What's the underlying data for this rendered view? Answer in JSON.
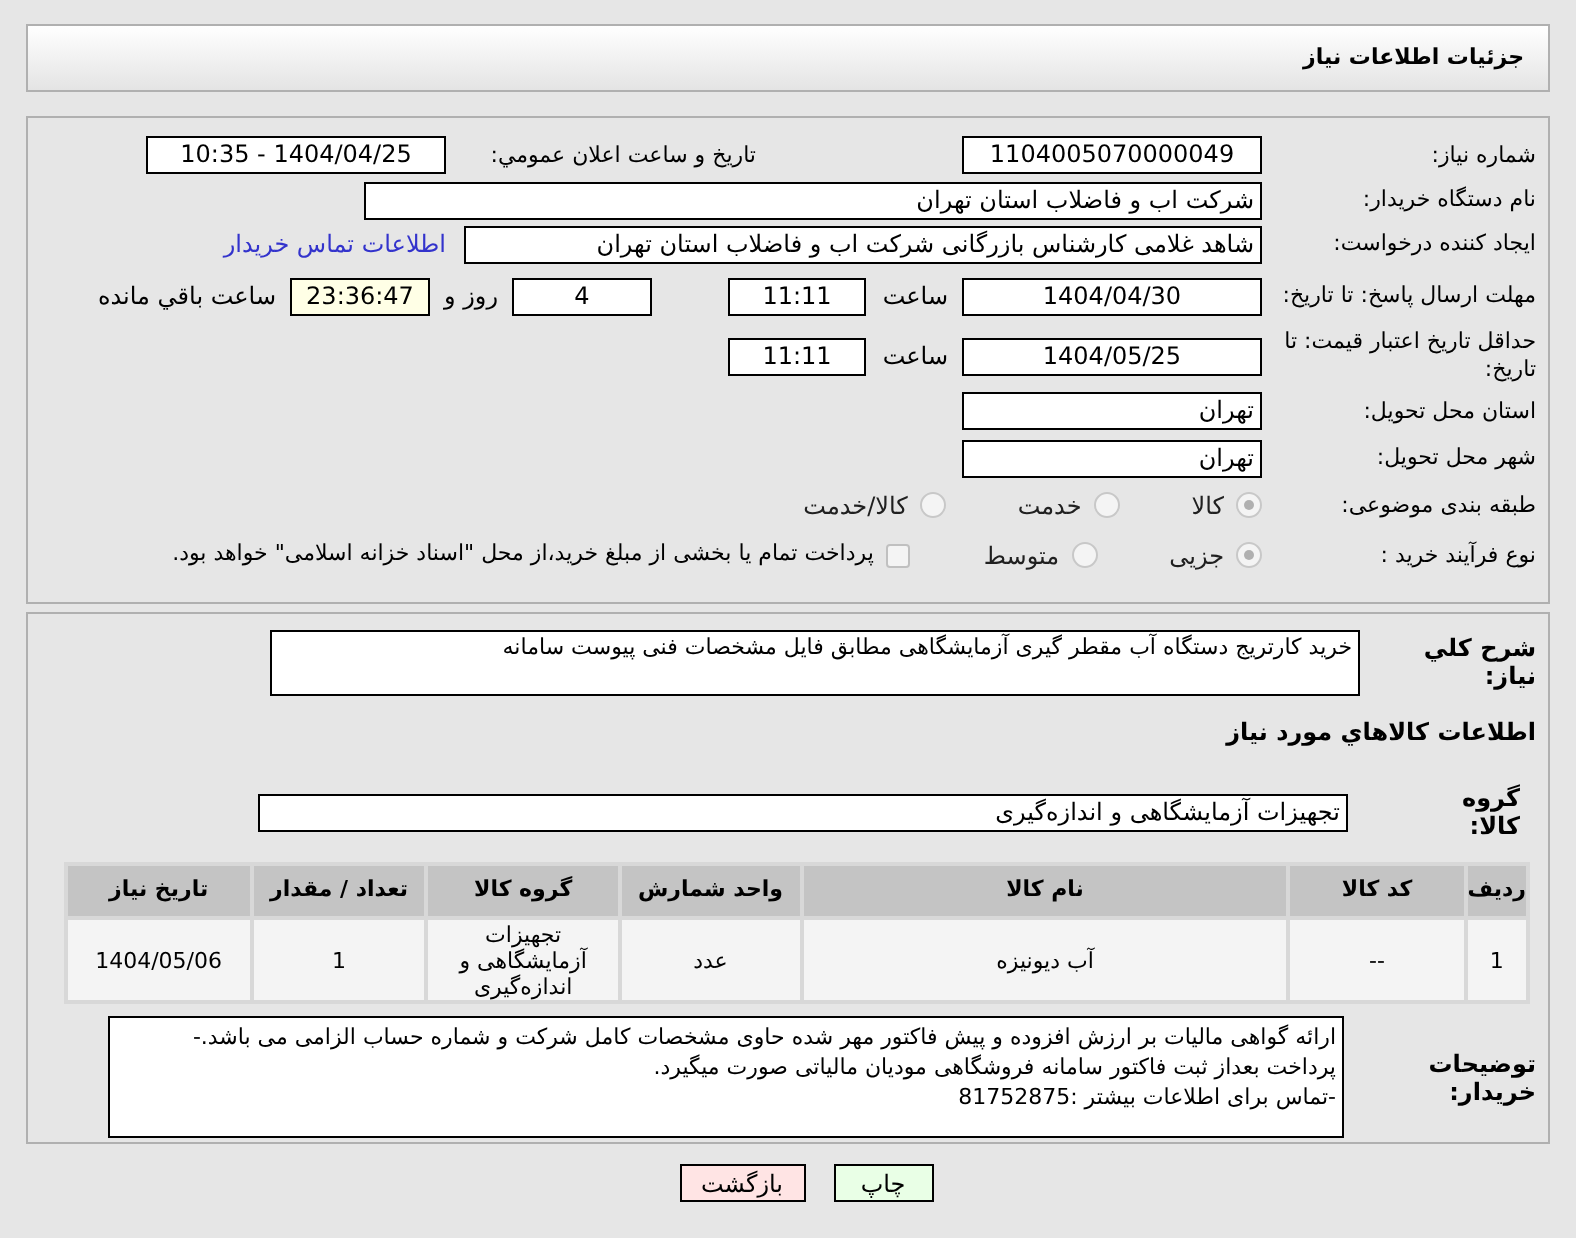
{
  "header": {
    "title": "جزئیات اطلاعات نیاز"
  },
  "need_number": {
    "label": "شماره نیاز:",
    "value": "1104005070000049"
  },
  "announce": {
    "label": "تاریخ و ساعت اعلان عمومي:",
    "value": "1404/04/25 - 10:35"
  },
  "buyer_org": {
    "label": "نام دستگاه خریدار:",
    "value": "شرکت اب و فاضلاب استان تهران"
  },
  "requester": {
    "label": "ایجاد کننده درخواست:",
    "value": "شاهد غلامی کارشناس بازرگانی شرکت اب و فاضلاب استان تهران",
    "link": "اطلاعات تماس خریدار"
  },
  "reply_deadline": {
    "label": "مهلت ارسال پاسخ: تا تاریخ:",
    "date": "1404/04/30",
    "time_label": "ساعت",
    "time": "11:11",
    "days": "4",
    "days_label": "روز و",
    "remaining": "23:36:47",
    "remaining_label": "ساعت باقي مانده"
  },
  "price_validity": {
    "label": "حداقل تاریخ اعتبار قیمت: تا تاریخ:",
    "date": "1404/05/25",
    "time_label": "ساعت",
    "time": "11:11"
  },
  "province": {
    "label": "استان محل تحویل:",
    "value": "تهران"
  },
  "city": {
    "label": "شهر محل تحویل:",
    "value": "تهران"
  },
  "category": {
    "label": "طبقه بندی موضوعی:",
    "options": [
      {
        "label": "کالا",
        "selected": true
      },
      {
        "label": "خدمت",
        "selected": false
      },
      {
        "label": "کالا/خدمت",
        "selected": false
      }
    ]
  },
  "purchase_type": {
    "label": "نوع فرآیند خرید :",
    "options": [
      {
        "label": "جزیی",
        "selected": true
      },
      {
        "label": "متوسط",
        "selected": false
      }
    ],
    "treasury": {
      "label": "پرداخت تمام یا بخشی از مبلغ خرید،از محل \"اسناد خزانه اسلامی\" خواهد بود.",
      "checked": false
    }
  },
  "description": {
    "label": "شرح کلي نیاز:",
    "value": "خرید کارتریج دستگاه آب مقطر گیری آزمایشگاهی مطابق فایل مشخصات فنی پیوست سامانه"
  },
  "goods_title": "اطلاعات کالاهاي مورد نیاز",
  "goods_group": {
    "label": "گروه کالا:",
    "value": "تجهیزات آزمایشگاهی و اندازه‌گیری"
  },
  "table": {
    "columns": [
      "ردیف",
      "کد کالا",
      "نام کالا",
      "واحد شمارش",
      "گروه کالا",
      "تعداد / مقدار",
      "تاریخ نیاز"
    ],
    "rows": [
      [
        "1",
        "--",
        "آب دیونیزه",
        "عدد",
        "تجهیزات آزمایشگاهی و اندازه‌گیری",
        "1",
        "1404/05/06"
      ]
    ]
  },
  "buyer_notes": {
    "label": "توضیحات خریدار:",
    "value": "ارائه گواهی مالیات بر ارزش افزوده و  پیش فاکتور مهر شده حاوی مشخصات کامل شرکت و شماره حساب الزامی می باشد.-\nپرداخت بعداز ثبت فاکتور سامانه فروشگاهی مودیان مالیاتی صورت میگیرد.\n-تماس برای اطلاعات بیشتر :81752875"
  },
  "buttons": [
    {
      "label": "چاپ",
      "kind": "print"
    },
    {
      "label": "بازگشت",
      "kind": "back"
    }
  ]
}
